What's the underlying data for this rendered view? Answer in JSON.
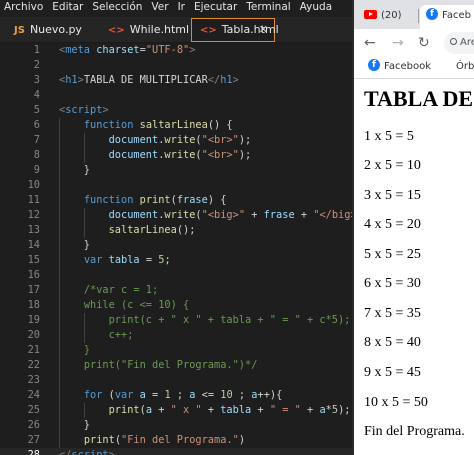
{
  "editor": {
    "menu": [
      "Archivo",
      "Editar",
      "Selección",
      "Ver",
      "Ir",
      "Ejecutar",
      "Terminal",
      "Ayuda"
    ],
    "tabs": [
      {
        "icon": "JS",
        "label": "Nuevo.py"
      },
      {
        "icon": "<>",
        "label": "While.html"
      },
      {
        "icon": "<>",
        "label": "Tabla.html",
        "close": "✕"
      }
    ],
    "line_numbers": [
      "1",
      "2",
      "3",
      "4",
      "5",
      "6",
      "7",
      "8",
      "9",
      "10",
      "11",
      "12",
      "13",
      "14",
      "15",
      "16",
      "17",
      "18",
      "19",
      "20",
      "21",
      "22",
      "23",
      "24",
      "25",
      "26",
      "27",
      "28"
    ],
    "current_line": "28"
  },
  "browser": {
    "tabs": [
      {
        "label": "(20)"
      },
      {
        "label": "Faceb"
      }
    ],
    "nav": {
      "back": "←",
      "forward": "→",
      "reload": "↻",
      "url": "Are"
    },
    "bookmarks": [
      "Facebook",
      "Órbit"
    ],
    "page": {
      "heading": "TABLA DE",
      "rows": [
        "1 x 5 = 5",
        "2 x 5 = 10",
        "3 x 5 = 15",
        "4 x 5 = 20",
        "5 x 5 = 25",
        "6 x 5 = 30",
        "7 x 5 = 35",
        "8 x 5 = 40",
        "9 x 5 = 45",
        "10 x 5 = 50"
      ],
      "footer": "Fin del Programa."
    }
  },
  "colors": {
    "editor_bg": "#1e1e1e",
    "active_tab_border": "#e08a2a",
    "keyword": "#569cd6",
    "string": "#ce9178",
    "function": "#dcdcaa",
    "variable": "#9cdcfe",
    "number": "#b5cea8",
    "comment": "#6a9955"
  }
}
